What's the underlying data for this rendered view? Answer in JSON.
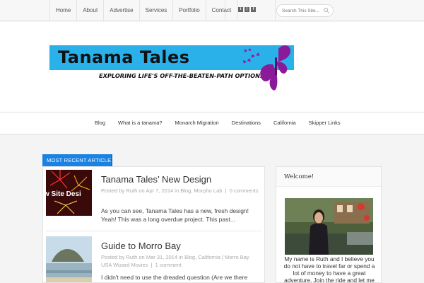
{
  "top_nav": [
    "Home",
    "About",
    "Advertise",
    "Services",
    "Portfolio",
    "Contact"
  ],
  "social_icons": [
    "twitter-icon",
    "rss-icon",
    "facebook-icon"
  ],
  "search": {
    "placeholder": "Search This Site..."
  },
  "logo": {
    "title": "Tanama Tales",
    "tagline": "Exploring Life's Off-the-Beaten-Path Options",
    "band_color": "#2ab1ea",
    "butterfly_color": "#8b1a9b"
  },
  "main_nav": [
    "Blog",
    "What is a tanama?",
    "Monarch Migration",
    "Destinations",
    "California",
    "Skipper Links"
  ],
  "recent": {
    "label": "MOST RECENT ARTICLE",
    "accent_color": "#1a82e2",
    "posts": [
      {
        "title": "Tanama Tales’ New Design",
        "meta_prefix": "Posted by",
        "author": "Ruth",
        "date_prefix": "on",
        "date": "Apr 7, 2014",
        "cat_prefix": "in",
        "categories": "Blog, Morpho Lab",
        "comments": "0 comments",
        "excerpt": "As you can see, Tanama Tales has a new, fresh design! Yeah! This was a long overdue project.  This past...",
        "thumb_text": "w Site Desi"
      },
      {
        "title": "Guide to Morro Bay",
        "meta_prefix": "Posted by",
        "author": "Ruth",
        "date_prefix": "on",
        "date": "Mar 31, 2014",
        "cat_prefix": "in",
        "categories": "Blog, California",
        "tags": "Morro Bay",
        "extra_tag": "USA Wizard Movies",
        "comments": "1 comment",
        "excerpt": "I didn't need to use the dreaded question (Are we there"
      }
    ]
  },
  "sidebar": {
    "heading": "Welcome!",
    "text": "My name is Ruth and I believe you do not have to travel far or spend a lot of money to have a great adventure. Join the ride and let me show you how to see the"
  }
}
